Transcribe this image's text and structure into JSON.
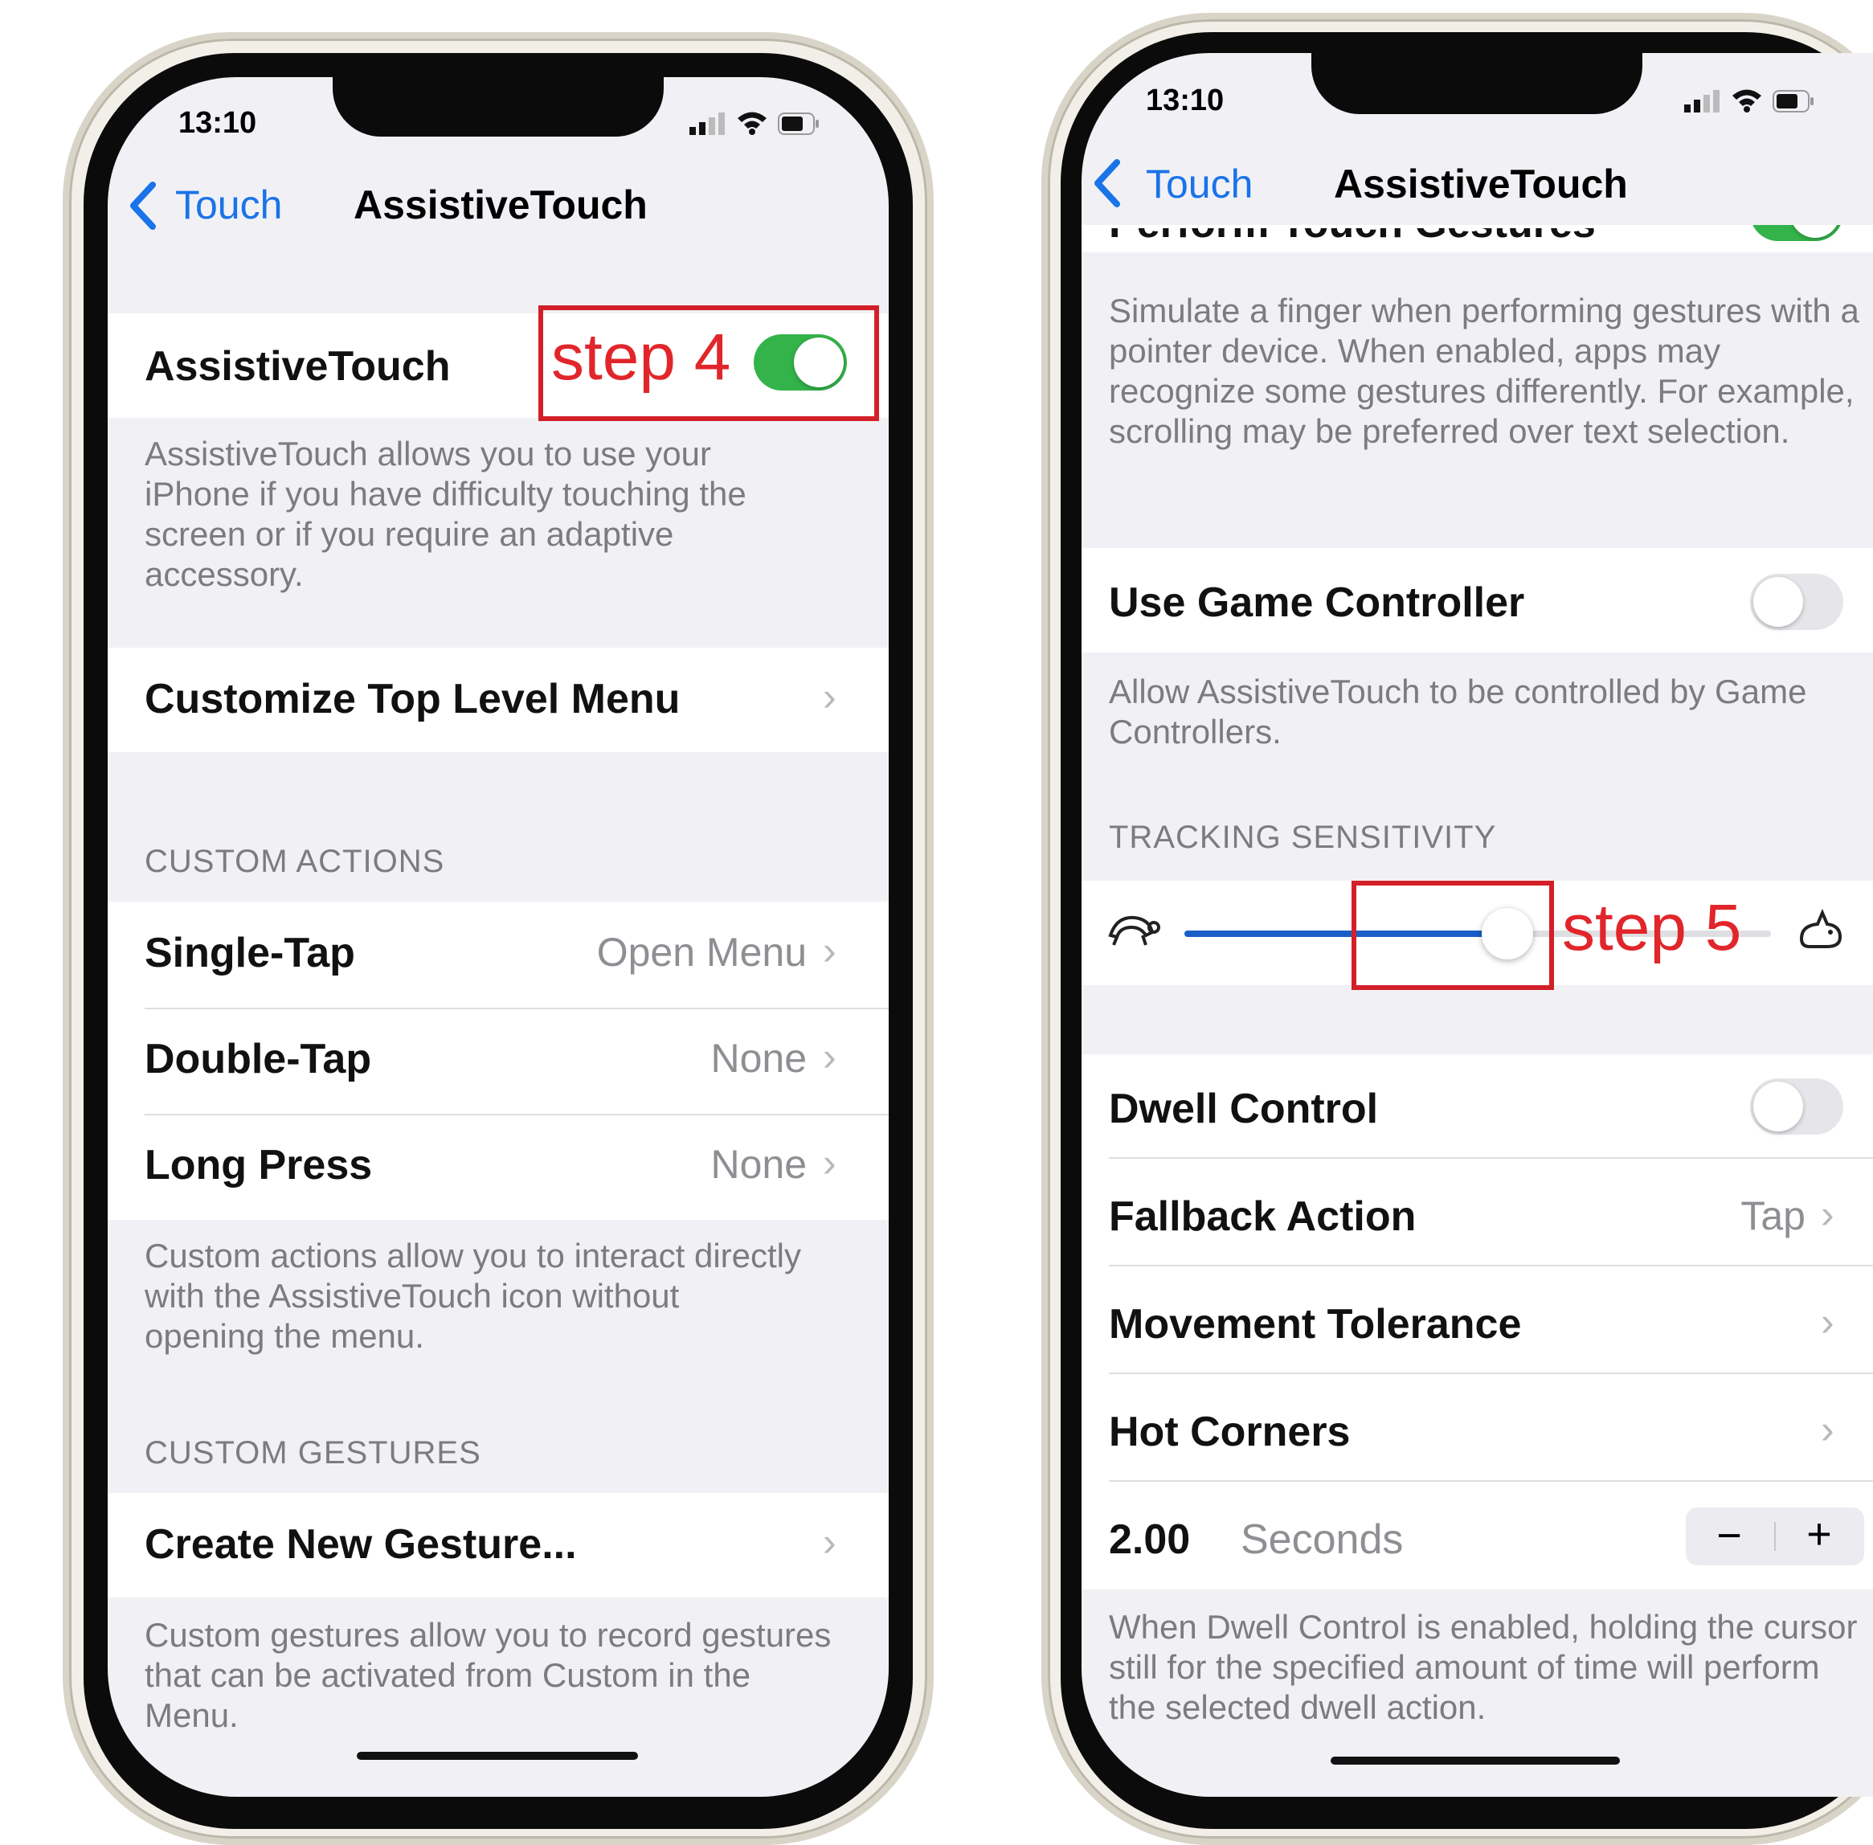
{
  "colors": {
    "accent": "#1a73e8",
    "toggle_on": "#34b34a",
    "toggle_off": "#e6e6ea",
    "annotation_red": "#d32028"
  },
  "left": {
    "status": {
      "time": "13:10"
    },
    "nav": {
      "back_label": "Touch",
      "title": "AssistiveTouch"
    },
    "assistive_row": {
      "label": "AssistiveTouch",
      "toggle_on": true
    },
    "annotation": "step 4",
    "assistive_footer": "AssistiveTouch allows you to use your iPhone if you have difficulty touching the screen or if you require an adaptive accessory.",
    "customize_label": "Customize Top Level Menu",
    "custom_actions_header": "CUSTOM ACTIONS",
    "actions": [
      {
        "label": "Single-Tap",
        "value": "Open Menu"
      },
      {
        "label": "Double-Tap",
        "value": "None"
      },
      {
        "label": "Long Press",
        "value": "None"
      }
    ],
    "actions_footer": "Custom actions allow you to interact directly with the AssistiveTouch icon without opening the menu.",
    "custom_gestures_header": "CUSTOM GESTURES",
    "create_gesture_label": "Create New Gesture...",
    "gestures_footer": "Custom gestures allow you to record gestures that can be activated from Custom in the Menu."
  },
  "right": {
    "status": {
      "time": "13:10"
    },
    "nav": {
      "back_label": "Touch",
      "title": "AssistiveTouch"
    },
    "partial_row_label": "Perform Touch Gestures",
    "perform_footer": "Simulate a finger when performing gestures with a pointer device. When enabled, apps may recognize some gestures differently. For example, scrolling may be preferred over text selection.",
    "game_controller": {
      "label": "Use Game Controller",
      "toggle_on": false
    },
    "game_footer": "Allow AssistiveTouch to be controlled by Game Controllers.",
    "tracking_header": "TRACKING SENSITIVITY",
    "tracking_level": 0.55,
    "annotation": "step 5",
    "dwell": {
      "label": "Dwell Control",
      "toggle_on": false
    },
    "fallback": {
      "label": "Fallback Action",
      "value": "Tap"
    },
    "movement_label": "Movement Tolerance",
    "hot_corners_label": "Hot Corners",
    "stepper": {
      "value": "2.00",
      "unit": "Seconds",
      "minus": "−",
      "plus": "+"
    },
    "dwell_footer": "When Dwell Control is enabled, holding the cursor still for the specified amount of time will perform the selected dwell action."
  }
}
